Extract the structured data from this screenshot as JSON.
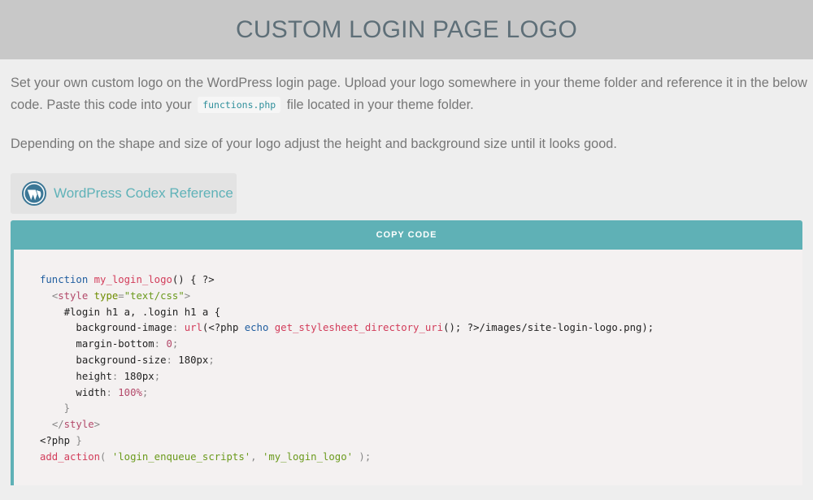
{
  "header": {
    "title": "CUSTOM LOGIN PAGE LOGO"
  },
  "intro": {
    "text_before": "Set your own custom logo on the WordPress login page. Upload your logo somewhere in your theme folder and reference it in the below code. Paste this code into your",
    "filename": "functions.php",
    "text_after": "file located in your theme folder."
  },
  "paragraph2": "Depending on the shape and size of your logo adjust the height and background size until it looks good.",
  "codex_button": {
    "label": "WordPress Codex Reference",
    "icon": "wordpress-icon"
  },
  "copy_button": {
    "label": "COPY CODE"
  },
  "code": {
    "l1": {
      "kw": "function",
      "fn": "my_login_logo",
      "rest": "() { ?>"
    },
    "l2": {
      "open": "<",
      "tag": "style",
      "attr": "type",
      "eq": "=",
      "val": "\"text/css\"",
      "close": ">"
    },
    "l3": {
      "selector": "#login h1 a, .login h1 a {"
    },
    "l4": {
      "prop": "background-image",
      "colon": ": ",
      "url": "url",
      "p1": "(<?php ",
      "echo": "echo",
      "sp": " ",
      "fn": "get_stylesheet_directory_uri",
      "p2": "(); ?>/images/site-login-logo.png);"
    },
    "l5": {
      "prop": "margin-bottom",
      "colon": ": ",
      "val": "0",
      "semi": ";"
    },
    "l6": {
      "prop": "background-size",
      "colon": ": ",
      "val": "180px",
      "semi": ";"
    },
    "l7": {
      "prop": "height",
      "colon": ": ",
      "val": "180px",
      "semi": ";"
    },
    "l8": {
      "prop": "width",
      "colon": ": ",
      "val": "100%",
      "semi": ";"
    },
    "l9": {
      "brace": "}"
    },
    "l10": {
      "open": "</",
      "tag": "style",
      "close": ">"
    },
    "l11": {
      "php": "<?php",
      "brace": " }"
    },
    "l12": {
      "fn": "add_action",
      "p1": "( ",
      "s1": "'login_enqueue_scripts'",
      "comma": ", ",
      "s2": "'my_login_logo'",
      "p2": " );"
    }
  },
  "colors": {
    "accent": "#5fb1b6",
    "header_bg": "#c8c8c8",
    "page_bg": "#eeeeee",
    "code_bg": "#f4f1f1"
  }
}
